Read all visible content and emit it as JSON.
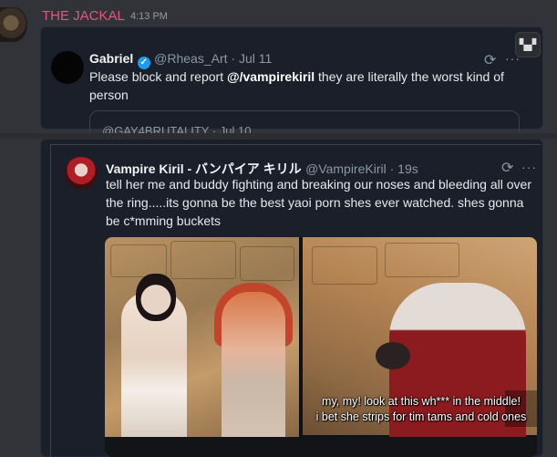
{
  "message": {
    "username": "THE JACKAL",
    "timestamp": "4:13 PM",
    "username_color": "#e8537f"
  },
  "embed1": {
    "author": "Gabriel",
    "handle": "@Rheas_Art · Jul 11",
    "text_prefix": "Please block and report ",
    "mention": "@/vampirekiril",
    "text_suffix": " they are literally the worst kind of person",
    "quoted_partial": "@GAY4BRUTALITY · Jul 10"
  },
  "embed2": {
    "author": "Vampire Kiril - バンパイア キリル",
    "handle": "@VampireKiril · 19s",
    "text": "tell her me and buddy fighting and breaking our noses and bleeding all over the ring.....its gonna be the best yaoi porn shes ever watched. shes gonna be c*mming buckets",
    "media_caption_line1": "my, my! look at this wh*** in the middle!",
    "media_caption_line2": "i bet she strips for tim tams and cold ones"
  },
  "icons": {
    "verified": "verified-badge-icon",
    "sync": "sync-icon",
    "more": "more-icon",
    "corner": "apps-icon"
  }
}
